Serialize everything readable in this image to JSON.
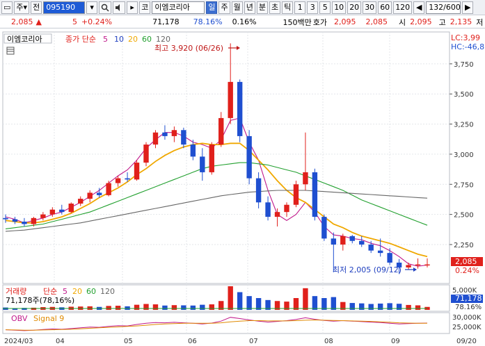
{
  "toolbar": {
    "market_label": "주",
    "prev_label": "전",
    "code": "095190",
    "search_icon": "search-icon",
    "speaker_icon": "speaker-icon",
    "category_label": "코",
    "stock_name": "이엠코리아",
    "periods": [
      "일",
      "주",
      "월",
      "년",
      "분",
      "초",
      "틱"
    ],
    "selected_period": "일",
    "intervals": [
      "1",
      "3",
      "5",
      "10",
      "20",
      "30",
      "60",
      "120"
    ],
    "count": "132/600",
    "scroll_left": "◀",
    "scroll_right": "▶"
  },
  "infobar": {
    "price": "2,085",
    "change_arrow": "▲",
    "change": "5",
    "change_pct": "+0.24%",
    "volume": "71,178",
    "volume_ratio": "78.16%",
    "turnover": "0.16%",
    "trade_value": "150백만",
    "ask_label": "호가",
    "ask1": "2,095",
    "bid1": "2,085",
    "open_label": "시",
    "open": "2,095",
    "high_label": "고",
    "high": "2,135",
    "high_suffix": "저"
  },
  "price_panel": {
    "title": "이엠코리아",
    "ma_label": "종가 단순",
    "ma_periods": [
      "5",
      "10",
      "20",
      "60",
      "120"
    ],
    "ma_colors": [
      "#c0188a",
      "#1f3fbf",
      "#f0a800",
      "#22a02f",
      "#666666"
    ],
    "lc_label": "LC:3,99",
    "hc_label": "HC:-46,8",
    "high_annotation": "최고 3,920 (06/26)",
    "low_annotation": "최저 2,005 (09/12)",
    "current_price_tag": "2,085",
    "current_pct_tag": "0.24%",
    "y_ticks": [
      "3,750",
      "3,500",
      "3,250",
      "3,000",
      "2,750",
      "2,500",
      "2,250"
    ]
  },
  "volume_panel": {
    "label": "거래량",
    "ma_label": "단순",
    "ma_periods": [
      "5",
      "20",
      "60",
      "120"
    ],
    "value_text": "71,178주(78,16%)",
    "tag_value": "71,178",
    "tag_pct": "78.16%",
    "y_tick": "5,000K"
  },
  "obv_panel": {
    "label": "OBV",
    "signal_label": "Signal 9",
    "y_ticks": [
      "30,000K",
      "25,000K"
    ]
  },
  "x_axis": [
    "2024/03",
    "04",
    "05",
    "06",
    "07",
    "08",
    "09",
    "09/20"
  ],
  "colors": {
    "up": "#e0201b",
    "down": "#1f4fd0",
    "accent": "#1e5bd6",
    "ma5": "#c0188a",
    "ma10": "#1f3fbf",
    "ma20": "#f0a800",
    "ma60": "#22a02f",
    "ma120": "#666666"
  },
  "chart_data": {
    "type": "candlestick",
    "title": "이엠코리아",
    "y_axis_range": [
      2000,
      3920
    ],
    "x_range": [
      "2024/03",
      "2024/09/20"
    ],
    "annotations": [
      {
        "label": "최고",
        "value": 3920,
        "date": "06/26"
      },
      {
        "label": "최저",
        "value": 2005,
        "date": "09/12"
      }
    ],
    "last_close": 2085,
    "ma_series": [
      {
        "name": "5",
        "values": [
          2480,
          2460,
          2430,
          2450,
          2470,
          2500,
          2520,
          2560,
          2600,
          2650,
          2700,
          2760,
          2820,
          2870,
          2950,
          3050,
          3120,
          3180,
          3180,
          3150,
          3100,
          3080,
          3050,
          3120,
          3280,
          3300,
          3100,
          2950,
          2700,
          2500,
          2450,
          2500,
          2600,
          2520,
          2400,
          2330,
          2320,
          2300,
          2290,
          2260,
          2240,
          2200,
          2150,
          2090,
          2070,
          2080
        ]
      },
      {
        "name": "20",
        "values": [
          2450,
          2440,
          2430,
          2430,
          2440,
          2460,
          2480,
          2510,
          2550,
          2590,
          2640,
          2680,
          2720,
          2770,
          2830,
          2880,
          2940,
          2990,
          3030,
          3060,
          3080,
          3090,
          3080,
          3080,
          3090,
          3090,
          3030,
          2950,
          2870,
          2780,
          2700,
          2640,
          2600,
          2540,
          2480,
          2420,
          2390,
          2350,
          2320,
          2300,
          2280,
          2260,
          2230,
          2200,
          2170,
          2150
        ]
      },
      {
        "name": "60",
        "values": [
          2380,
          2390,
          2400,
          2410,
          2420,
          2440,
          2460,
          2480,
          2500,
          2520,
          2550,
          2580,
          2610,
          2640,
          2670,
          2700,
          2730,
          2760,
          2790,
          2820,
          2850,
          2880,
          2900,
          2910,
          2920,
          2930,
          2930,
          2920,
          2910,
          2890,
          2870,
          2850,
          2820,
          2790,
          2760,
          2730,
          2700,
          2660,
          2620,
          2590,
          2560,
          2530,
          2500,
          2470,
          2440,
          2410
        ]
      },
      {
        "name": "120",
        "values": [
          2360,
          2365,
          2370,
          2380,
          2390,
          2400,
          2410,
          2420,
          2430,
          2445,
          2460,
          2475,
          2490,
          2505,
          2520,
          2535,
          2550,
          2565,
          2580,
          2595,
          2610,
          2625,
          2640,
          2655,
          2665,
          2675,
          2685,
          2690,
          2695,
          2700,
          2700,
          2700,
          2700,
          2695,
          2690,
          2685,
          2680,
          2675,
          2670,
          2665,
          2660,
          2655,
          2650,
          2645,
          2640,
          2635
        ]
      }
    ],
    "candles": [
      [
        2470,
        2500,
        2430,
        2460
      ],
      [
        2460,
        2480,
        2420,
        2440
      ],
      [
        2440,
        2470,
        2400,
        2420
      ],
      [
        2420,
        2480,
        2400,
        2470
      ],
      [
        2470,
        2520,
        2450,
        2500
      ],
      [
        2500,
        2560,
        2480,
        2540
      ],
      [
        2540,
        2580,
        2500,
        2520
      ],
      [
        2520,
        2600,
        2510,
        2590
      ],
      [
        2590,
        2650,
        2570,
        2630
      ],
      [
        2630,
        2700,
        2600,
        2680
      ],
      [
        2680,
        2720,
        2640,
        2660
      ],
      [
        2660,
        2780,
        2650,
        2760
      ],
      [
        2760,
        2820,
        2730,
        2800
      ],
      [
        2800,
        2850,
        2770,
        2790
      ],
      [
        2790,
        2950,
        2780,
        2930
      ],
      [
        2930,
        3100,
        2900,
        3080
      ],
      [
        3080,
        3200,
        3050,
        3180
      ],
      [
        3180,
        3240,
        3120,
        3150
      ],
      [
        3150,
        3230,
        3100,
        3200
      ],
      [
        3200,
        3220,
        3050,
        3080
      ],
      [
        3080,
        3120,
        2950,
        2980
      ],
      [
        2980,
        3050,
        2780,
        2850
      ],
      [
        2850,
        3100,
        2830,
        3080
      ],
      [
        3080,
        3350,
        3060,
        3300
      ],
      [
        3300,
        3920,
        3250,
        3600
      ],
      [
        3600,
        3620,
        3100,
        3150
      ],
      [
        3150,
        3200,
        2750,
        2800
      ],
      [
        2800,
        2850,
        2550,
        2600
      ],
      [
        2600,
        2650,
        2450,
        2480
      ],
      [
        2480,
        2550,
        2400,
        2520
      ],
      [
        2520,
        2600,
        2480,
        2580
      ],
      [
        2580,
        2780,
        2560,
        2750
      ],
      [
        2750,
        3180,
        2700,
        2850
      ],
      [
        2850,
        2880,
        2450,
        2480
      ],
      [
        2480,
        2500,
        2280,
        2300
      ],
      [
        2300,
        2350,
        2020,
        2250
      ],
      [
        2250,
        2340,
        2200,
        2320
      ],
      [
        2320,
        2330,
        2260,
        2280
      ],
      [
        2280,
        2320,
        2230,
        2250
      ],
      [
        2250,
        2280,
        2180,
        2200
      ],
      [
        2200,
        2300,
        2150,
        2180
      ],
      [
        2180,
        2220,
        2080,
        2100
      ],
      [
        2100,
        2130,
        2005,
        2060
      ],
      [
        2060,
        2100,
        2040,
        2080
      ],
      [
        2080,
        2135,
        2050,
        2085
      ],
      [
        2085,
        2135,
        2060,
        2085
      ]
    ],
    "volume_values": [
      120,
      90,
      100,
      110,
      140,
      150,
      130,
      160,
      170,
      180,
      150,
      200,
      210,
      180,
      260,
      300,
      280,
      220,
      240,
      230,
      220,
      260,
      280,
      450,
      1200,
      900,
      700,
      600,
      500,
      450,
      420,
      600,
      1100,
      700,
      600,
      650,
      400,
      350,
      330,
      300,
      320,
      340,
      310,
      250,
      230,
      150
    ],
    "obv_series": [
      {
        "name": "OBV",
        "values": [
          24000,
          23800,
          23600,
          23800,
          24100,
          24300,
          24200,
          24500,
          24800,
          25100,
          25000,
          25400,
          25700,
          25600,
          26200,
          26700,
          27000,
          26900,
          27100,
          26900,
          26700,
          26400,
          26800,
          27600,
          29200,
          28700,
          28100,
          27600,
          27200,
          27500,
          27800,
          28300,
          29000,
          28400,
          27900,
          27600,
          27800,
          27600,
          27400,
          27200,
          27000,
          26700,
          26400,
          26600,
          26700,
          26800
        ]
      },
      {
        "name": "Signal 9",
        "values": [
          24000,
          23900,
          23800,
          23800,
          23900,
          24000,
          24100,
          24200,
          24400,
          24600,
          24800,
          25000,
          25200,
          25400,
          25600,
          25900,
          26200,
          26400,
          26600,
          26700,
          26700,
          26700,
          26700,
          26900,
          27300,
          27600,
          27800,
          27800,
          27700,
          27700,
          27700,
          27800,
          28000,
          28100,
          28000,
          27900,
          27800,
          27700,
          27600,
          27500,
          27300,
          27100,
          26900,
          26800,
          26700,
          26700
        ]
      }
    ]
  }
}
